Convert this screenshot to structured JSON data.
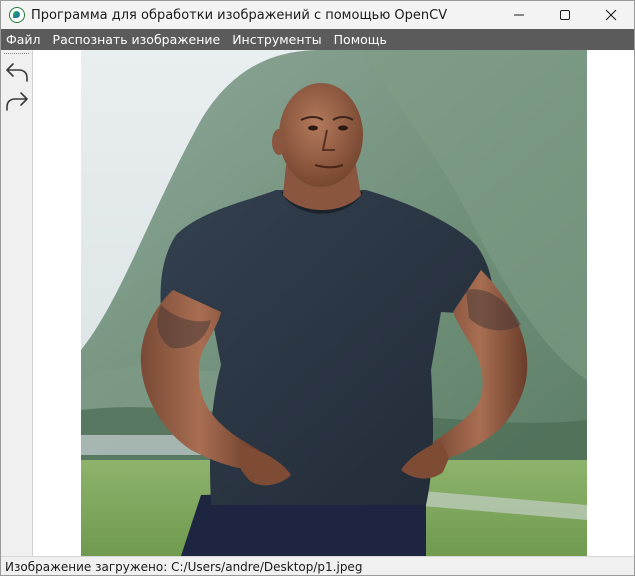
{
  "window": {
    "title": "Программа для обработки изображений с помощью OpenCV",
    "controls": [
      "minimize-icon",
      "maximize-icon",
      "close-icon"
    ]
  },
  "menu": {
    "items": [
      {
        "label": "Файл"
      },
      {
        "label": "Распознать изображение"
      },
      {
        "label": "Инструменты"
      },
      {
        "label": "Помощь"
      }
    ]
  },
  "toolbar": {
    "buttons": [
      {
        "icon": "undo-arrow-icon"
      },
      {
        "icon": "redo-arrow-icon"
      }
    ]
  },
  "image": {
    "icon": "photo-image"
  },
  "status": {
    "text": "Изображение загружено: C:/Users/andre/Desktop/p1.jpeg"
  },
  "colors": {
    "menubar_bg": "#5b5b5b",
    "titlebar_bg": "#f3f3f3",
    "shirt": "#2c3646",
    "sky": "#dfe6e8"
  }
}
